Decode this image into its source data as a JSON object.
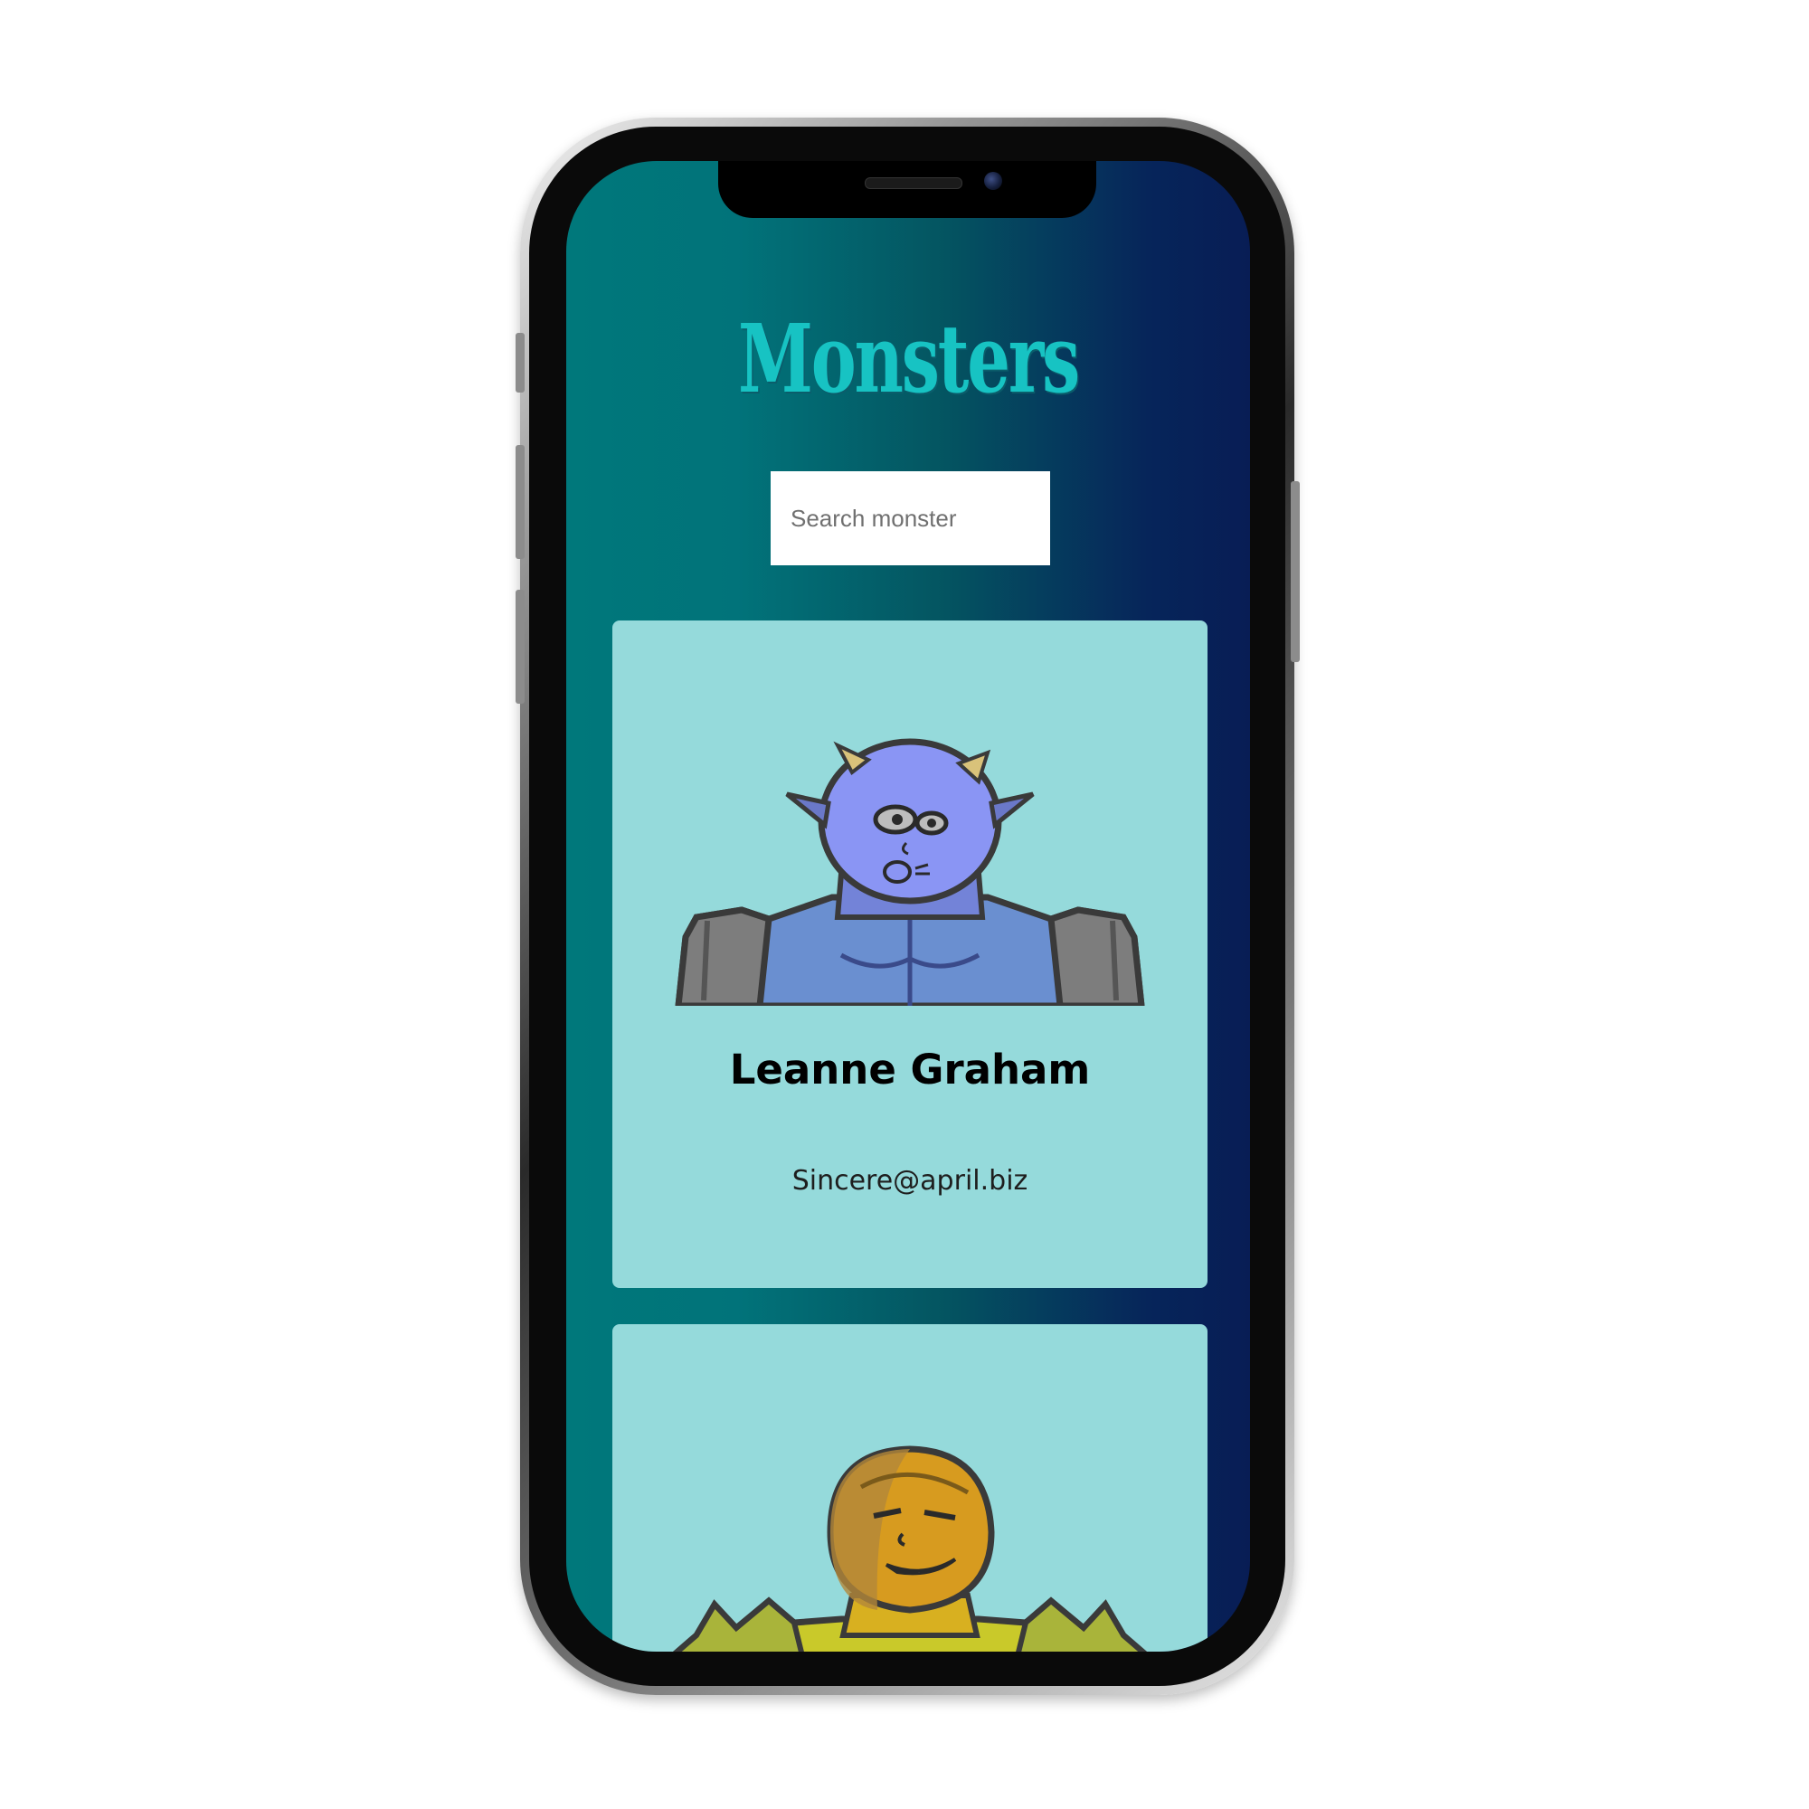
{
  "app": {
    "title": "Monsters"
  },
  "search": {
    "placeholder": "Search monster",
    "value": ""
  },
  "monsters": [
    {
      "name": "Leanne Graham",
      "email": "Sincere@april.biz",
      "avatar": "blue-horned-monster"
    },
    {
      "name": "",
      "email": "",
      "avatar": "orange-spiky-monster"
    }
  ],
  "colors": {
    "background_gradient_start": "#00787b",
    "background_gradient_end": "#081d55",
    "card_background": "#95dadb",
    "title_color": "#17c3c3"
  }
}
